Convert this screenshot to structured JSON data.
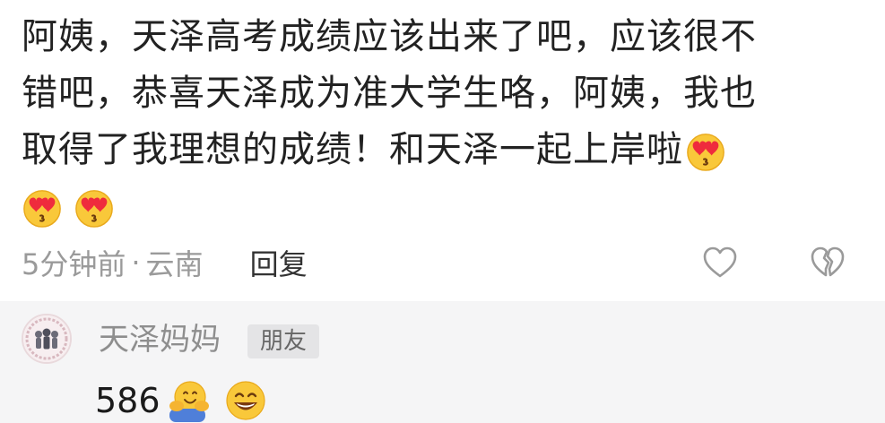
{
  "comment": {
    "line1": "阿姨，天泽高考成绩应该出来了吧，应该很不",
    "line2": "错吧，恭喜天泽成为准大学生咯，阿姨，我也",
    "line3": "取得了我理想的成绩！和天泽一起上岸啦",
    "emojis": [
      "smiling-face-with-heart-eyes-kissing-emoji",
      "smiling-face-with-heart-eyes-kissing-emoji",
      "smiling-face-with-heart-eyes-kissing-emoji"
    ]
  },
  "meta": {
    "time": "5分钟前",
    "separator": "·",
    "location": "云南",
    "reply_label": "回复",
    "icons": [
      "like-heart-icon",
      "dislike-broken-heart-icon"
    ]
  },
  "reply": {
    "author": "天泽妈妈",
    "badge": "朋友",
    "text": "586",
    "emojis": [
      "hugging-face-emoji",
      "grinning-face-emoji"
    ]
  },
  "colors": {
    "text_primary": "#222222",
    "text_muted": "#9a9a9a",
    "reply_bg": "#f5f5f6",
    "badge_bg": "#e4e4e6"
  }
}
